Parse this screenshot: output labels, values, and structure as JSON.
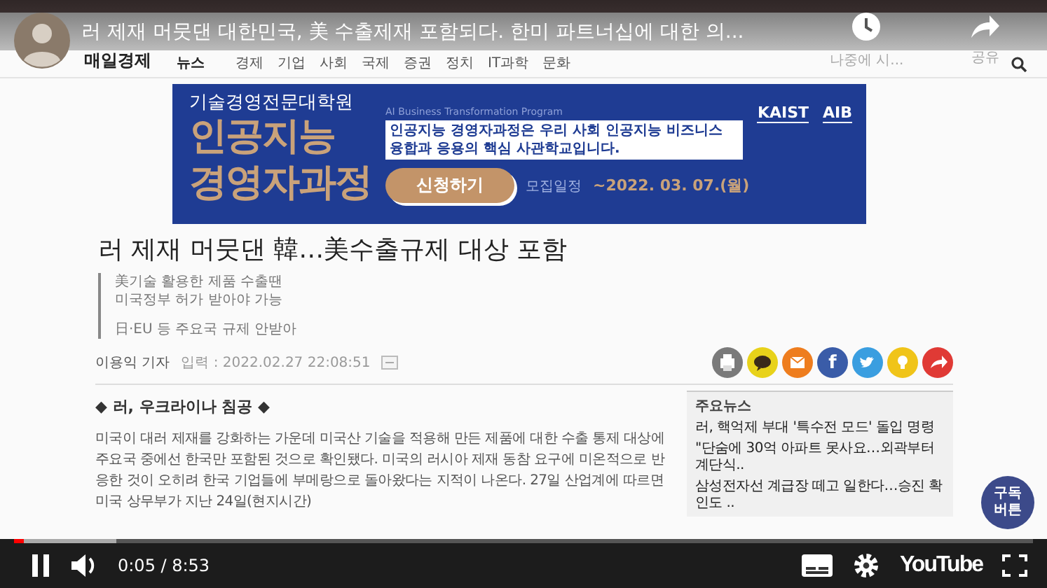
{
  "player": {
    "title": "러 제재 머뭇댄 대한민국, 美 수출제재 포함되다. 한미 파트너십에 대한 의...",
    "watch_later_label": "나중에 시...",
    "share_label": "공유",
    "subscribe_badge": "구독 버튼",
    "playing": true,
    "progress": {
      "level": 0.01
    },
    "buffer": {
      "level": 0.1
    },
    "time": "0:05 / 8:53",
    "brand": "YouTube"
  },
  "site": {
    "logo": "매일경제",
    "section": "뉴스",
    "nav": [
      "경제",
      "기업",
      "사회",
      "국제",
      "증권",
      "정치",
      "IT과학",
      "문화"
    ]
  },
  "banner": {
    "school": "기술경영전문대학원",
    "headline_lines": [
      "인공지능",
      "경영자과정"
    ],
    "program": "AI Business Transformation Program",
    "description": "인공지능 경영자과정은 우리 사회 인공지능 비즈니스 융합과 응용의 핵심 사관학교입니다.",
    "button": "신청하기",
    "schedule_label": "모집일정",
    "schedule_date": "~2022. 03. 07.(월)",
    "logos": [
      "KAIST",
      "AIB"
    ]
  },
  "article": {
    "headline": "러 제재 머뭇댄 韓…美수출규제 대상 포함",
    "subhead_groups": [
      {
        "lines": [
          "美기술 활용한 제품 수출땐",
          "미국정부 허가 받아야 가능"
        ]
      },
      {
        "lines": [
          "日·EU 등 주요국 규제 안받아"
        ]
      }
    ],
    "reporter": "이용익 기자",
    "posted": "입력 : 2022.02.27 22:08:51",
    "section_title": "◆ 러, 우크라이나 침공 ◆",
    "body": "미국이 대러 제재를 강화하는 가운데 미국산 기술을 적용해 만든 제품에 대한 수출 통제 대상에 주요국 중에선 한국만 포함된 것으로 확인됐다. 미국의 러시아 제재 동참 요구에 미온적으로 반응한 것이 오히려 한국 기업들에 부메랑으로 돌아왔다는 지적이 나온다. 27일 산업계에 따르면 미국 상무부가 지난 24일(현지시간)"
  },
  "share_buttons": [
    {
      "kind": "print",
      "color": "#7a7a7a"
    },
    {
      "kind": "kakao",
      "color": "#e8d21a"
    },
    {
      "kind": "mail",
      "color": "#ee7d1e"
    },
    {
      "kind": "facebook",
      "color": "#3a5ca8",
      "glyph": "f"
    },
    {
      "kind": "twitter",
      "color": "#3a9ee0"
    },
    {
      "kind": "bulb",
      "color": "#f0c419"
    },
    {
      "kind": "share",
      "color": "#e03a35"
    }
  ],
  "top_news": {
    "title": "주요뉴스",
    "items": [
      "러, 핵억제 부대 '특수전 모드' 돌입 명령",
      "\"단숨에 30억 아파트 못사요…외곽부터 계단식..",
      "삼성전자선 계급장 떼고 일한다…승진 확인도 .."
    ]
  }
}
